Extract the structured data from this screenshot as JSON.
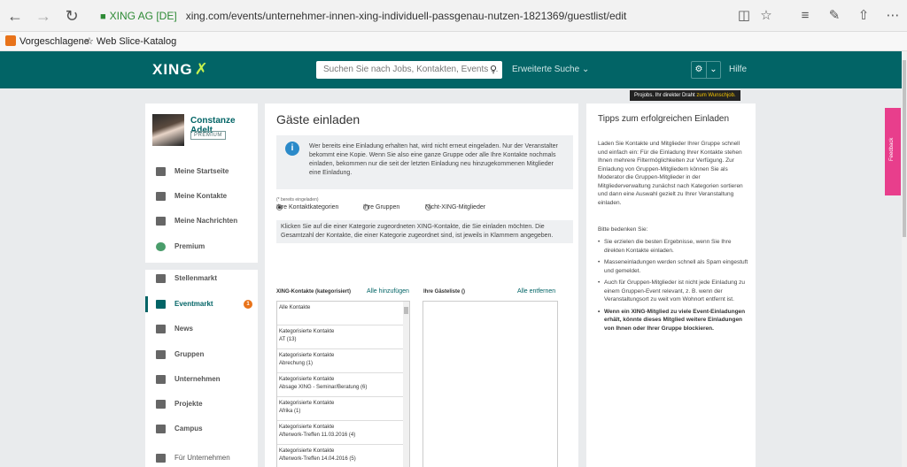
{
  "browser": {
    "secure_label": "XING AG [DE]",
    "url": "xing.com/events/unternehmer-innen-xing-individuell-passgenau-nutzen-1821369/guestlist/edit",
    "favorites": [
      "Vorgeschlagene",
      "Web Slice-Katalog"
    ]
  },
  "header": {
    "logo": "XING",
    "search_placeholder": "Suchen Sie nach Jobs, Kontakten, Events ...",
    "advanced_search": "Erweiterte Suche",
    "help": "Hilfe",
    "promo_prefix": "Projobs. Ihr direkter Draht",
    "promo_highlight": "zum Wunschjob."
  },
  "sidebar": {
    "user_name": "Constanze Adelt",
    "badge": "PREMIUM",
    "items": [
      {
        "label": "Meine Startseite",
        "icon": "home-icon"
      },
      {
        "label": "Meine Kontakte",
        "icon": "contacts-icon"
      },
      {
        "label": "Meine Nachrichten",
        "icon": "messages-icon"
      },
      {
        "label": "Premium",
        "icon": "premium-icon"
      },
      {
        "label": "Stellenmarkt",
        "icon": "jobs-icon"
      },
      {
        "label": "Eventmarkt",
        "icon": "calendar-icon",
        "count": "1"
      },
      {
        "label": "News",
        "icon": "news-icon"
      },
      {
        "label": "Gruppen",
        "icon": "groups-icon"
      },
      {
        "label": "Unternehmen",
        "icon": "companies-icon"
      },
      {
        "label": "Projekte",
        "icon": "projects-icon"
      },
      {
        "label": "Campus",
        "icon": "campus-icon"
      },
      {
        "label": "Für Unternehmen",
        "icon": "business-icon"
      }
    ]
  },
  "main": {
    "title": "Gäste einladen",
    "info": "Wer bereits eine Einladung erhalten hat, wird nicht erneut eingeladen. Nur der Veranstalter bekommt eine Kopie. Wenn Sie also eine ganze Gruppe oder alle Ihre Kontakte nochmals einladen, bekommen nur die seit der letzten Einladung neu hinzugekommenen Mitglieder eine Einladung.",
    "already_invited": "(* bereits eingeladen)",
    "radios": [
      "Ihre Kontaktkategorien",
      "Ihre Gruppen",
      "Nicht-XING-Mitglieder"
    ],
    "instructions": "Klicken Sie auf die einer Kategorie zugeordneten XING-Kontakte, die Sie einladen möchten. Die Gesamtzahl der Kontakte, die einer Kategorie zugeordnet sind, ist jeweils in Klammern angegeben.",
    "left_header": "XING-Kontakte (kategorisiert)",
    "add_all": "Alle hinzufügen",
    "right_header": "Ihre Gästeliste ()",
    "remove_all": "Alle entfernen",
    "contacts": [
      {
        "line1": "Alle Kontakte",
        "line2": ""
      },
      {
        "line1": "Kategorisierte Kontakte",
        "line2": "AT (13)"
      },
      {
        "line1": "Kategorisierte Kontakte",
        "line2": "Abrechung (1)"
      },
      {
        "line1": "Kategorisierte Kontakte",
        "line2": "Absage XING - Seminar/Beratung (6)"
      },
      {
        "line1": "Kategorisierte Kontakte",
        "line2": "Afrika (1)"
      },
      {
        "line1": "Kategorisierte Kontakte",
        "line2": "Afterwork-Treffen 11.03.2016 (4)"
      },
      {
        "line1": "Kategorisierte Kontakte",
        "line2": "Afterwork-Treffen 14.04.2016 (5)"
      }
    ]
  },
  "tips": {
    "title": "Tipps zum erfolgreichen Einladen",
    "intro": "Laden Sie Kontakte und Mitglieder Ihrer Gruppe schnell und einfach ein: Für die Einladung Ihrer Kontakte stehen Ihnen mehrere Filtermöglichkeiten zur Verfügung. Zur Einladung von Gruppen-Mitgliedern können Sie als Moderator die Gruppen-Mitglieder in der Mitgliederverwaltung zunächst nach Kategorien sortieren und dann eine Auswahl gezielt zu Ihrer Veranstaltung einladen.",
    "note": "Bitte bedenken Sie:",
    "bullets": [
      "Sie erzielen die besten Ergebnisse, wenn Sie Ihre direkten Kontakte einladen.",
      "Masseneinladungen werden schnell als Spam eingestuft und gemeldet.",
      "Auch für Gruppen-Mitglieder ist nicht jede Einladung zu einem Gruppen-Event relevant, z. B. wenn der Veranstaltungsort zu weit vom Wohnort entfernt ist."
    ],
    "bold_bullet": "Wenn ein XING-Mitglied zu viele Event-Einladungen erhält, könnte dieses Mitglied weitere Einladungen von Ihnen oder Ihrer Gruppe blockieren."
  },
  "feedback": "Feedback",
  "colors": {
    "brand": "#026466",
    "accent": "#c6f24e",
    "badge": "#e8731a",
    "feedback": "#e83e8c"
  }
}
